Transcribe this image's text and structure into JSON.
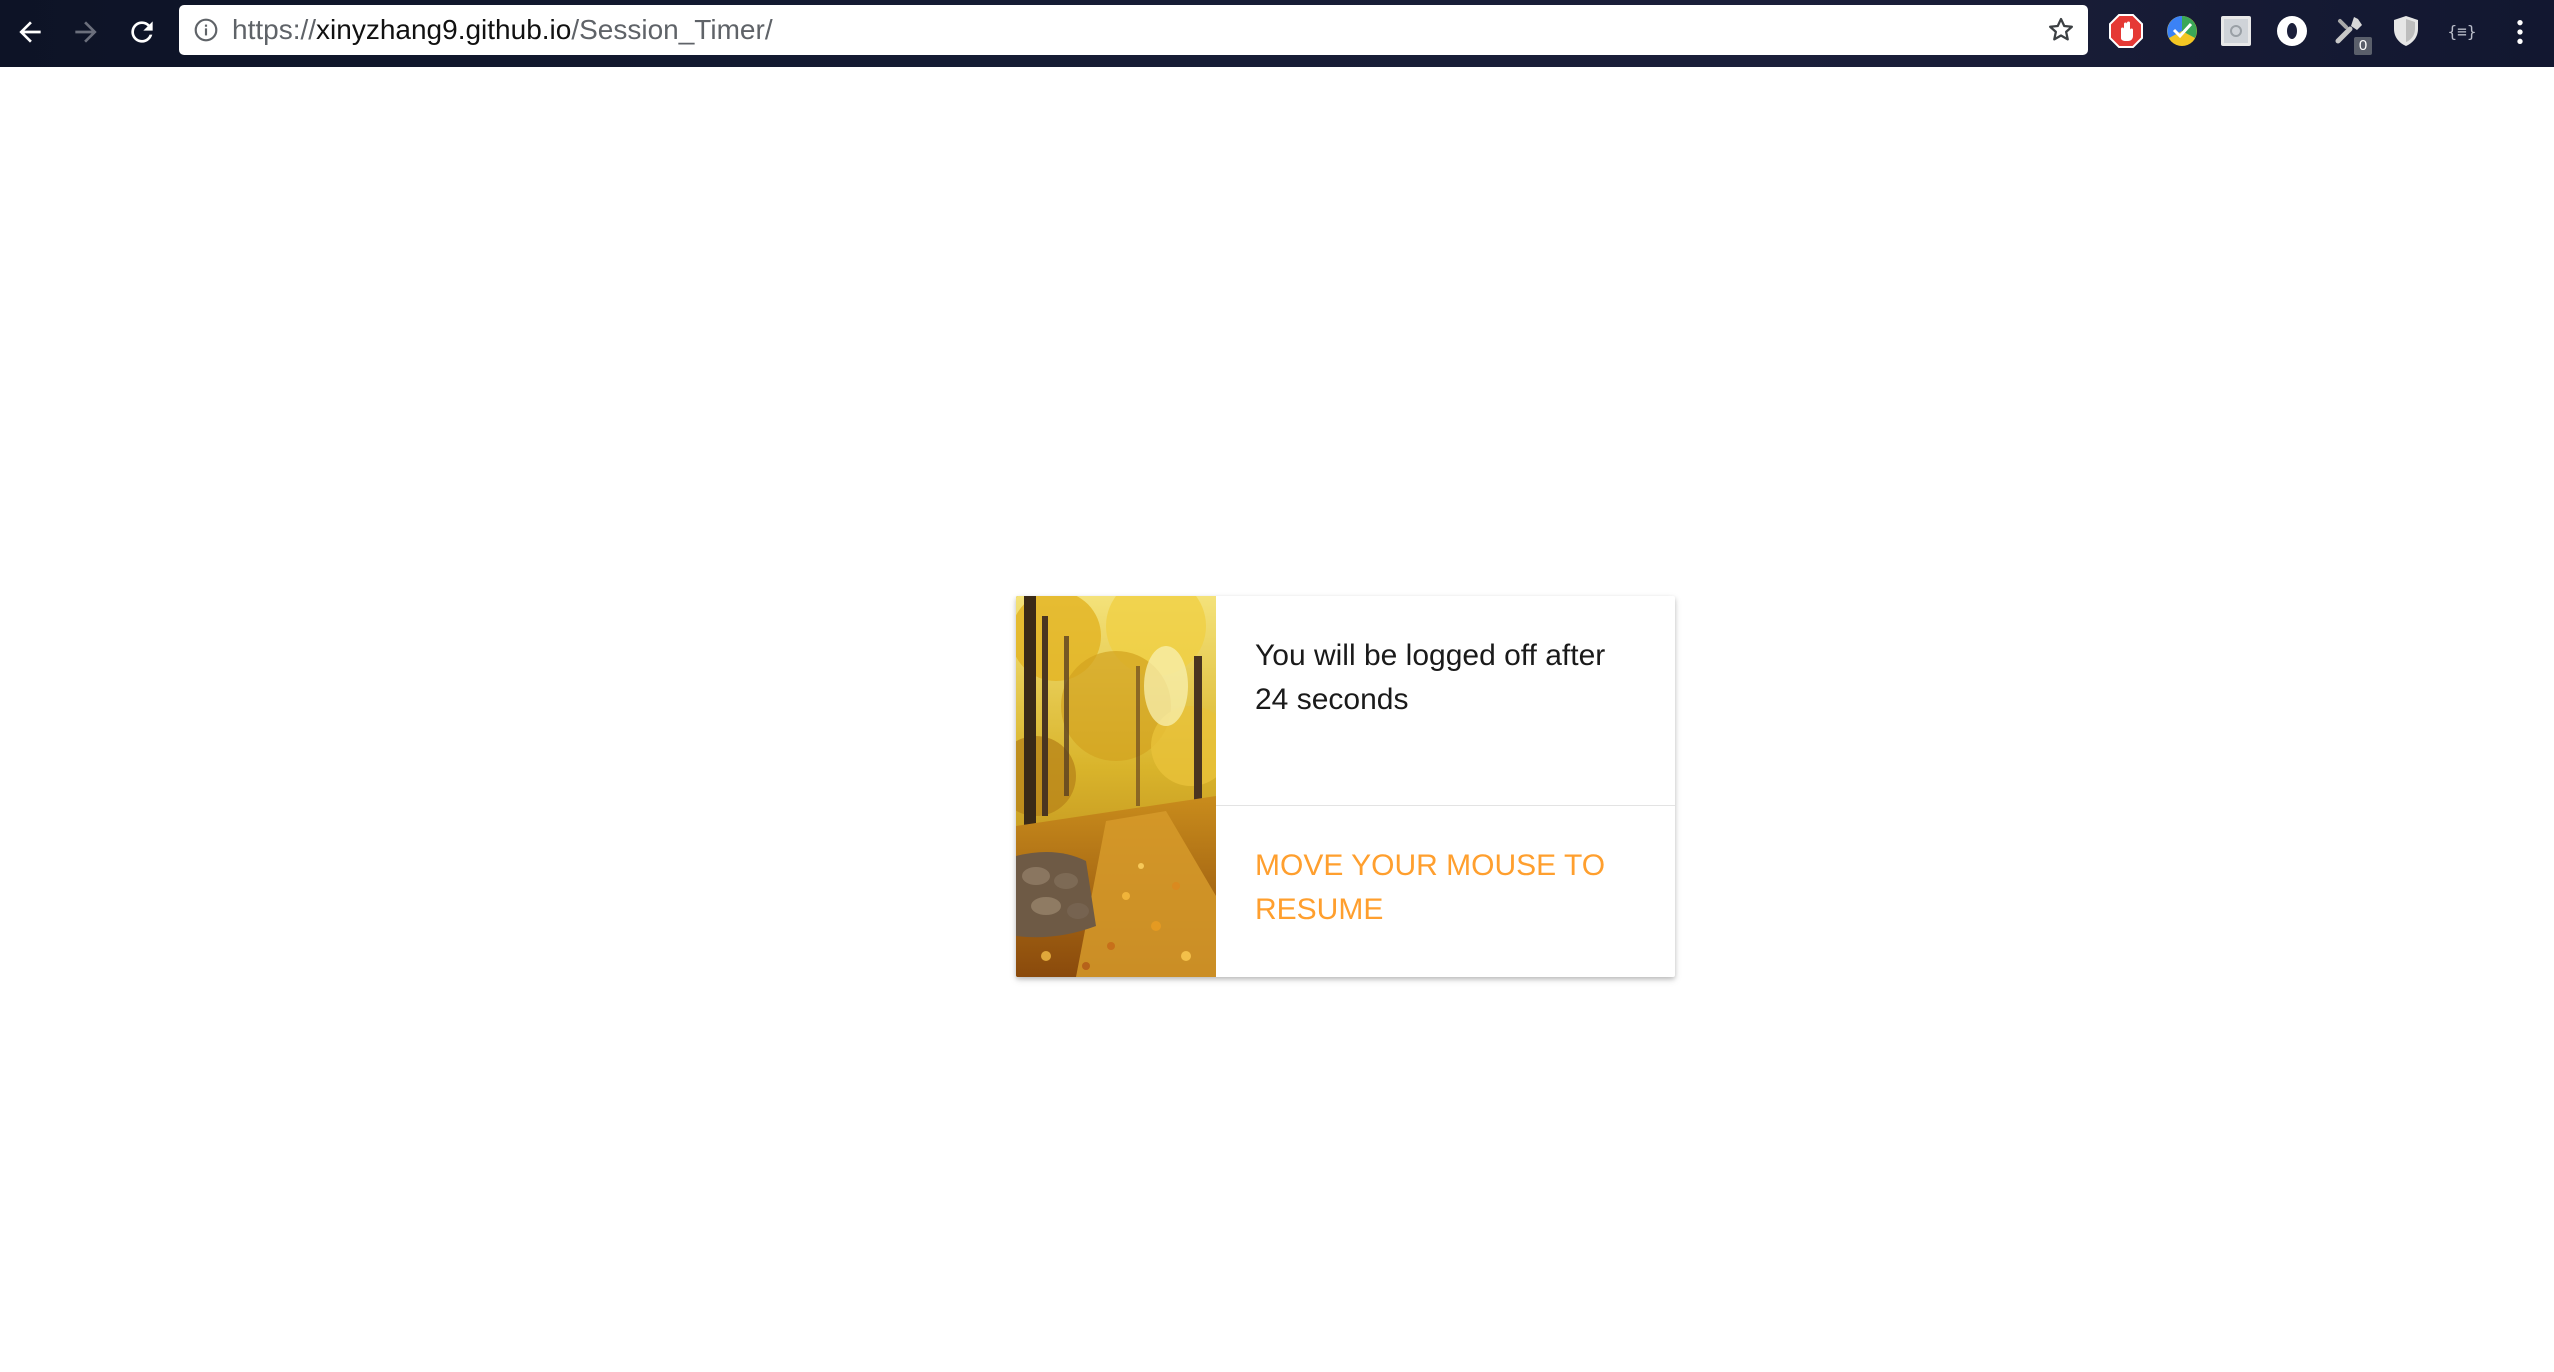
{
  "browser": {
    "url_scheme": "https://",
    "url_host": "xinyzhang9.github.io",
    "url_path": "/Session_Timer/",
    "extensions": [
      {
        "name": "adblock-icon",
        "color": "#e53935"
      },
      {
        "name": "colorpick-icon",
        "color": "#4caf50"
      },
      {
        "name": "screenshot-icon",
        "color": "#e0e0e0"
      },
      {
        "name": "o-icon",
        "color": "#ffffff"
      },
      {
        "name": "tools-icon",
        "color": "#c8c8c8",
        "badge": "0"
      },
      {
        "name": "shield-icon",
        "color": "#e6e6e6"
      },
      {
        "name": "json-braces-icon",
        "label": "{≡}"
      }
    ]
  },
  "card": {
    "message_line1": "You will be logged off after",
    "message_line2": "24 seconds",
    "action_line1": "MOVE YOUR MOUSE TO",
    "action_line2": "RESUME",
    "action_color": "#ff9f2e",
    "image": "autumn-forest-path-image"
  }
}
